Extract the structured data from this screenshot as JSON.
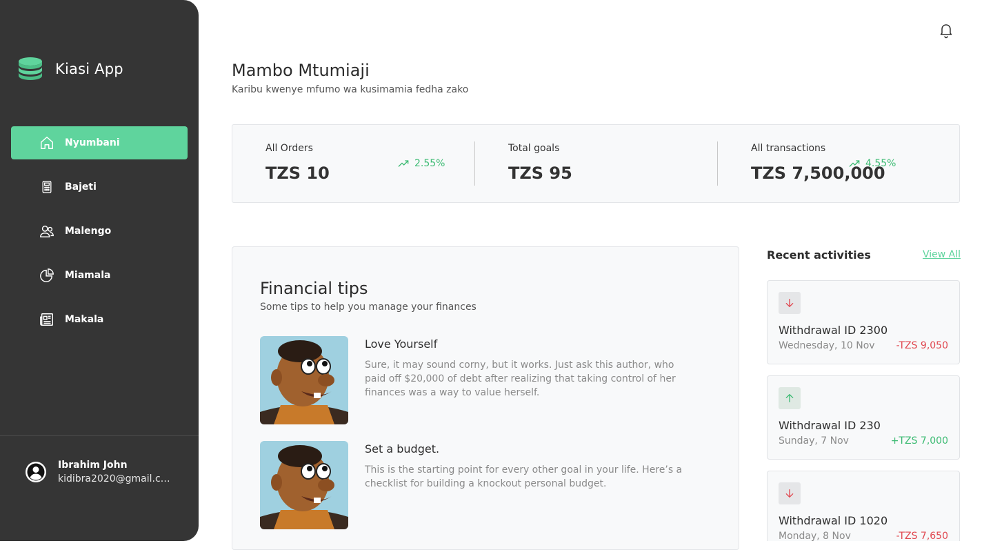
{
  "brand": {
    "name": "Kiasi App"
  },
  "colors": {
    "sidebar": "#353535",
    "accent": "#5fd49d",
    "positive": "#3dbb73",
    "negative": "#e0474f"
  },
  "sidebar": {
    "items": [
      {
        "label": "Nyumbani",
        "icon": "home-icon",
        "active": true
      },
      {
        "label": "Bajeti",
        "icon": "calculator-icon",
        "active": false
      },
      {
        "label": "Malengo",
        "icon": "users-icon",
        "active": false
      },
      {
        "label": "Miamala",
        "icon": "pie-chart-icon",
        "active": false
      },
      {
        "label": "Makala",
        "icon": "newspaper-icon",
        "active": false
      }
    ]
  },
  "user": {
    "name": "Ibrahim John",
    "email": "kidibra2020@gmail.com"
  },
  "header": {
    "title": "Mambo Mtumiaji",
    "subtitle": "Karibu kwenye mfumo wa kusimamia fedha zako",
    "bell_icon": "bell-icon"
  },
  "stats": [
    {
      "label": "All Orders",
      "value": "TZS 10",
      "change": "2.55%"
    },
    {
      "label": "Total goals",
      "value": "TZS 95",
      "change": ""
    },
    {
      "label": "All transactions",
      "value": "TZS 7,500,000",
      "change": "4.55%"
    }
  ],
  "tips": {
    "title": "Financial tips",
    "subtitle": "Some tips to help you manage your finances",
    "items": [
      {
        "title": "Love Yourself",
        "body": "Sure, it may sound corny, but it works. Just ask this author, who paid off $20,000 of debt after realizing that taking control of her finances was a way to value herself."
      },
      {
        "title": "Set a budget.",
        "body": "This is the starting point for every other goal in your life. Here’s a checklist for building a knockout personal budget."
      }
    ]
  },
  "recent": {
    "title": "Recent activities",
    "view_all": "View All",
    "items": [
      {
        "title": "Withdrawal ID 2300",
        "date": "Wednesday, 10 Nov",
        "amount": "-TZS 9,050",
        "direction": "down"
      },
      {
        "title": "Withdrawal ID 230",
        "date": "Sunday, 7 Nov",
        "amount": "+TZS 7,000",
        "direction": "up"
      },
      {
        "title": "Withdrawal ID 1020",
        "date": "Monday, 8 Nov",
        "amount": "-TZS 7,650",
        "direction": "down"
      }
    ]
  }
}
